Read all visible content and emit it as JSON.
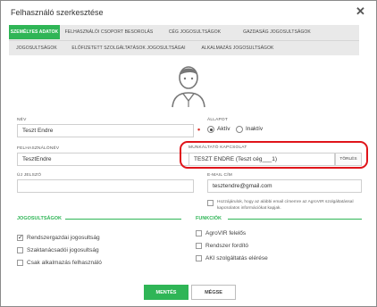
{
  "dialog": {
    "title": "Felhasználó szerkesztése"
  },
  "tabs": [
    {
      "label": "Személyes adatok",
      "active": true
    },
    {
      "label": "Felhasználói csoport besorolás",
      "active": false
    },
    {
      "label": "Cég jogosultságok",
      "active": false
    },
    {
      "label": "Gazdaság jogosultságok",
      "active": false
    },
    {
      "label": "Jogosultságok",
      "active": false
    },
    {
      "label": "Előfizetett szolgáltatások jogosultságai",
      "active": false
    },
    {
      "label": "Alkalmazás jogosultságok",
      "active": false
    }
  ],
  "form": {
    "name_label": "Név",
    "name_value": "Teszt Endre",
    "username_label": "Felhasználónév",
    "username_value": "TesztEndre",
    "password_label": "Új jelszó",
    "password_value": "",
    "status_label": "Állapot",
    "status_active": "Aktív",
    "status_inactive": "Inaktív",
    "employer_label": "Munkáltató kapcsolat",
    "employer_value": "TESZT ENDRE (Teszt cég___1)",
    "clear_label": "Törlés",
    "email_label": "E-mail cím",
    "email_value": "tesztendre@gmail.com",
    "consent_text": "Hozzájárulok, hogy az alábbi email címemre az AgroVIR szolgáltatással kapcsolatos információkat kapjak."
  },
  "permissions": {
    "title": "Jogosultságok",
    "items": [
      {
        "label": "Rendszergazdai jogosultság",
        "checked": true
      },
      {
        "label": "Szaktanácsadói jogosultság",
        "checked": false
      },
      {
        "label": "Csak alkalmazás felhasználó",
        "checked": false
      }
    ]
  },
  "functions": {
    "title": "Funkciók",
    "items": [
      {
        "label": "AgroVIR felelős",
        "checked": false
      },
      {
        "label": "Rendszer fordító",
        "checked": false
      },
      {
        "label": "AKI szolgáltatás elérése",
        "checked": false
      }
    ]
  },
  "footer": {
    "save_label": "Mentés",
    "cancel_label": "Mégse"
  },
  "colors": {
    "accent": "#2fb556",
    "highlight": "#e0141a",
    "required": "#d9322b"
  }
}
